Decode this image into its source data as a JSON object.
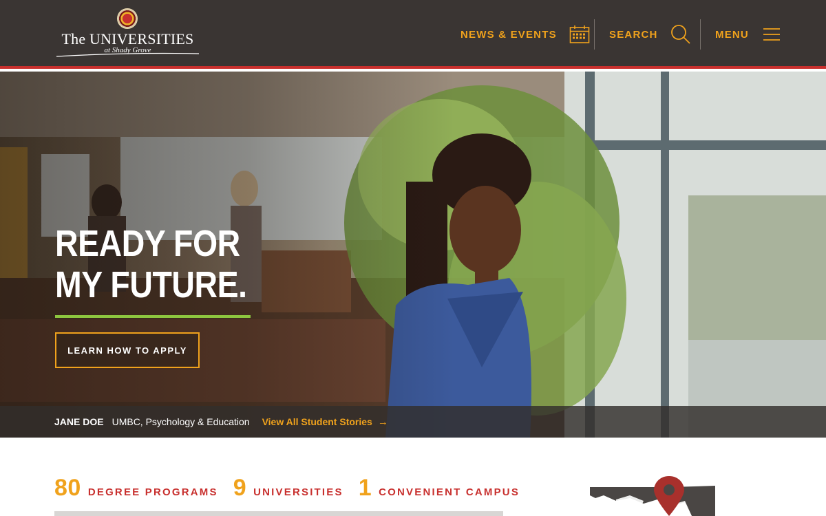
{
  "header": {
    "logo": {
      "main": "The UNIVERSITIES",
      "sub": "at Shady Grove"
    },
    "nav": [
      {
        "label": "NEWS & EVENTS",
        "icon": "calendar-icon"
      },
      {
        "label": "SEARCH",
        "icon": "search-icon"
      },
      {
        "label": "MENU",
        "icon": "hamburger-menu-icon"
      }
    ]
  },
  "hero": {
    "title_line1": "READY FOR",
    "title_line2": "MY FUTURE.",
    "apply_button": "LEARN HOW TO APPLY",
    "caption": {
      "name": "JANE DOE",
      "program": "UMBC, Psychology & Education",
      "link": "View All Student Stories",
      "link_icon": "arrow-right-icon"
    }
  },
  "stats": [
    {
      "number": "80",
      "label": "DEGREE PROGRAMS"
    },
    {
      "number": "9",
      "label": "UNIVERSITIES"
    },
    {
      "number": "1",
      "label": "CONVENIENT CAMPUS"
    }
  ],
  "map": {
    "icon": "map-pin-icon"
  },
  "colors": {
    "header_bg": "#3a3533",
    "accent_red": "#c8302e",
    "accent_orange": "#f0a21c",
    "accent_green": "#8dc63f"
  }
}
